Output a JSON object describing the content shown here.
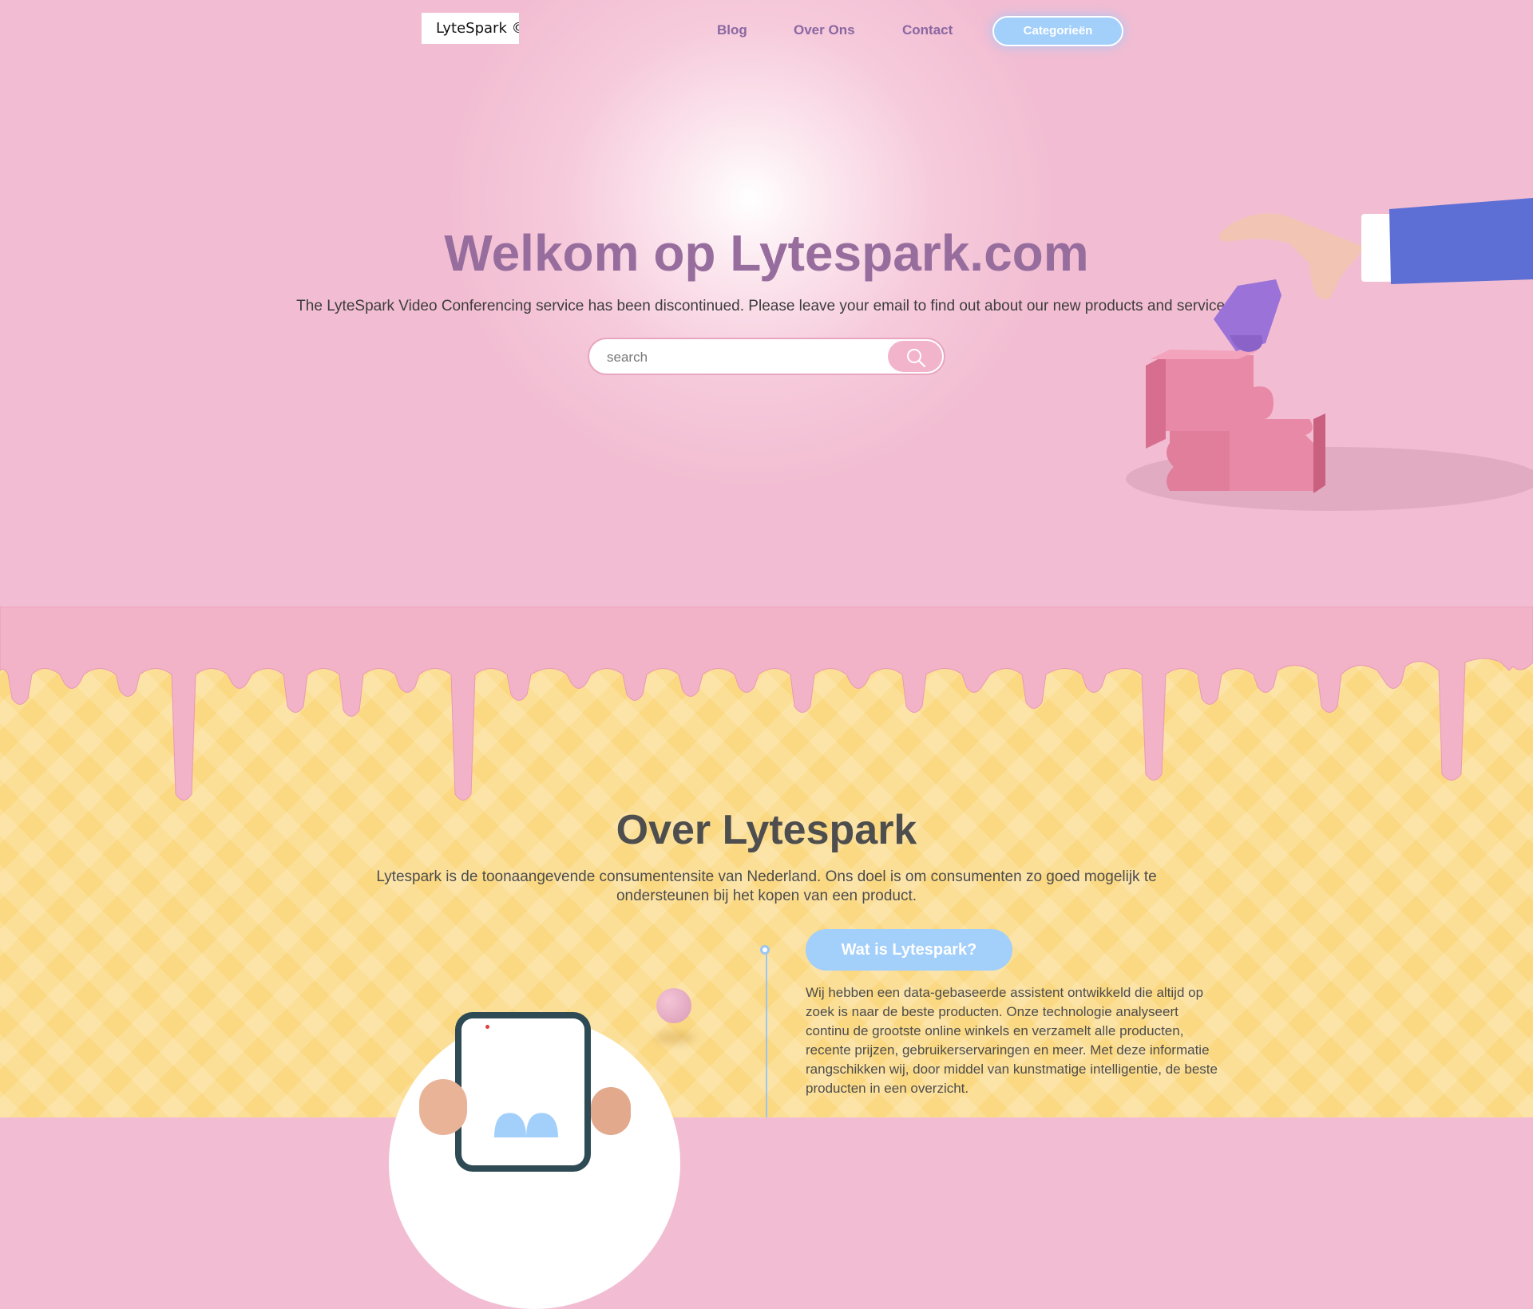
{
  "header": {
    "logo_text": "LyteSpark © (",
    "nav": {
      "blog": "Blog",
      "over_ons": "Over Ons",
      "contact": "Contact"
    },
    "cta": "Categorieën"
  },
  "hero": {
    "title": "Welkom op Lytespark.com",
    "subtitle": "The LyteSpark Video Conferencing service has been discontinued. Please leave your email to find out about our new products and services.",
    "search": {
      "placeholder": "search",
      "value": ""
    }
  },
  "about": {
    "title": "Over Lytespark",
    "intro": "Lytespark is de toonaangevende consumentensite van Nederland. Ons doel is om consumenten zo goed mogelijk te ondersteunen bij het kopen van een product.",
    "pill": "Wat is Lytespark?",
    "body": "Wij hebben een data-gebaseerde assistent ontwikkeld die altijd op zoek is naar de beste producten. Onze technologie analyseert continu de grootste online winkels en verzamelt alle producten, recente prijzen, gebruikerservaringen en meer. Met deze informatie rangschikken wij, door middel van kunstmatige intelligentie, de beste producten in een overzicht."
  },
  "colors": {
    "hero_bg": "#f2bdd2",
    "accent_purple": "#976d9e",
    "accent_blue": "#a3cffb",
    "waffle": "#fbd983",
    "drip": "#f2b2c8"
  },
  "icons": [
    "search-icon",
    "puzzle-illustration",
    "hand-illustration",
    "phone-illustration"
  ]
}
